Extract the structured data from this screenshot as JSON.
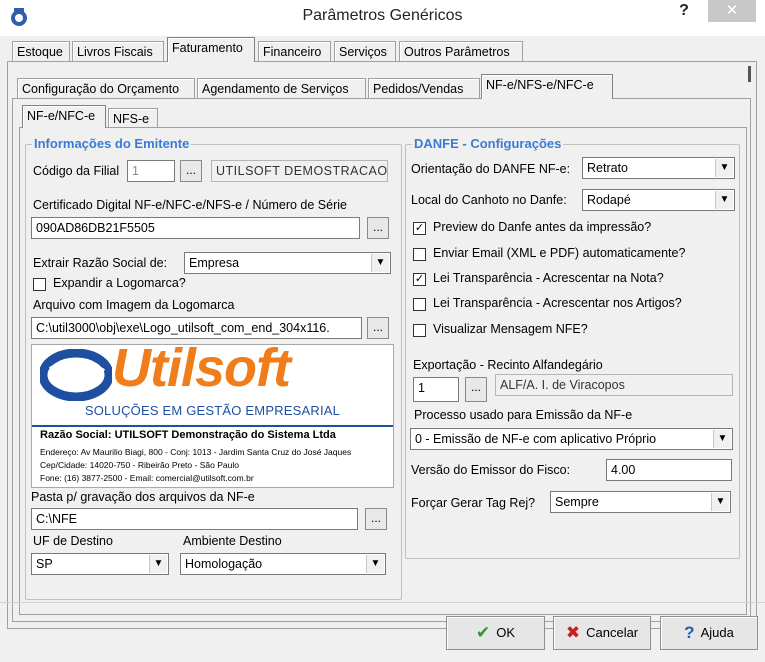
{
  "window": {
    "title": "Parâmetros Genéricos",
    "help_glyph": "?",
    "close_glyph": "✕"
  },
  "main_tabs": [
    "Estoque",
    "Livros Fiscais",
    "Faturamento",
    "Financeiro",
    "Serviços",
    "Outros Parâmetros"
  ],
  "sub_tabs": [
    "Configuração do Orçamento",
    "Agendamento de Serviços",
    "Pedidos/Vendas",
    "NF-e/NFS-e/NFC-e"
  ],
  "inner_tabs": [
    "NF-e/NFC-e",
    "NFS-e"
  ],
  "emitente": {
    "title": "Informações do Emitente",
    "codigo_filial_label": "Código da Filial",
    "codigo_filial_value": "1",
    "empresa_nome": "UTILSOFT DEMOSTRACAO",
    "certificado_label": "Certificado Digital NF-e/NFC-e/NFS-e / Número de Série",
    "certificado_value": "090AD86DB21F5505",
    "extrair_label": "Extrair Razão Social de:",
    "extrair_value": "Empresa",
    "expandir_label": "Expandir a Logomarca?",
    "arquivo_label": "Arquivo com Imagem da Logomarca",
    "arquivo_value": "C:\\util3000\\obj\\exe\\Logo_utilsoft_com_end_304x116.",
    "pasta_label": "Pasta p/ gravação dos arquivos da NF-e",
    "pasta_value": "C:\\NFE",
    "uf_label": "UF de Destino",
    "uf_value": "SP",
    "ambiente_label": "Ambiente Destino",
    "ambiente_value": "Homologação",
    "dots": "..."
  },
  "logo": {
    "word": "Utilsoft",
    "tagline": "SOLUÇÕES EM GESTÃO EMPRESARIAL",
    "razao": "Razão Social: UTILSOFT Demonstração do Sistema Ltda",
    "endereco": "Endereço: Av Maurilio Biagi, 800 - Conj: 1013 - Jardim Santa Cruz do José Jaques",
    "cep": "Cep/Cidade: 14020-750 - Ribeirão Preto - São Paulo",
    "fone": "Fone: (16) 3877-2500 - Email: comercial@utilsoft.com.br"
  },
  "danfe": {
    "title": "DANFE - Configurações",
    "orientacao_label": "Orientação do DANFE NF-e:",
    "orientacao_value": "Retrato",
    "canhoto_label": "Local do Canhoto no Danfe:",
    "canhoto_value": "Rodapé",
    "checks": [
      {
        "label": "Preview do Danfe antes da impressão?",
        "checked": true
      },
      {
        "label": "Enviar Email (XML e PDF) automaticamente?",
        "checked": false
      },
      {
        "label": "Lei Transparência - Acrescentar na  Nota?",
        "checked": true
      },
      {
        "label": "Lei Transparência - Acrescentar nos Artigos?",
        "checked": false
      },
      {
        "label": "Visualizar Mensagem NFE?",
        "checked": false
      }
    ],
    "exportacao_label": "Exportação - Recinto Alfandegário",
    "exportacao_code": "1",
    "exportacao_desc": "ALF/A. I. de Viracopos",
    "processo_label": "Processo usado para Emissão da NF-e",
    "processo_value": "0 - Emissão de NF-e com aplicativo Próprio",
    "versao_label": "Versão do Emissor do Fisco:",
    "versao_value": "4.00",
    "forcar_label": "Forçar Gerar Tag Rej?",
    "forcar_value": "Sempre"
  },
  "buttons": {
    "ok": "OK",
    "cancel": "Cancelar",
    "help": "Ajuda"
  },
  "colors": {
    "group_title": "#3a7bd5",
    "logo_orange": "#f07c1a",
    "logo_blue": "#1f4fa0"
  }
}
